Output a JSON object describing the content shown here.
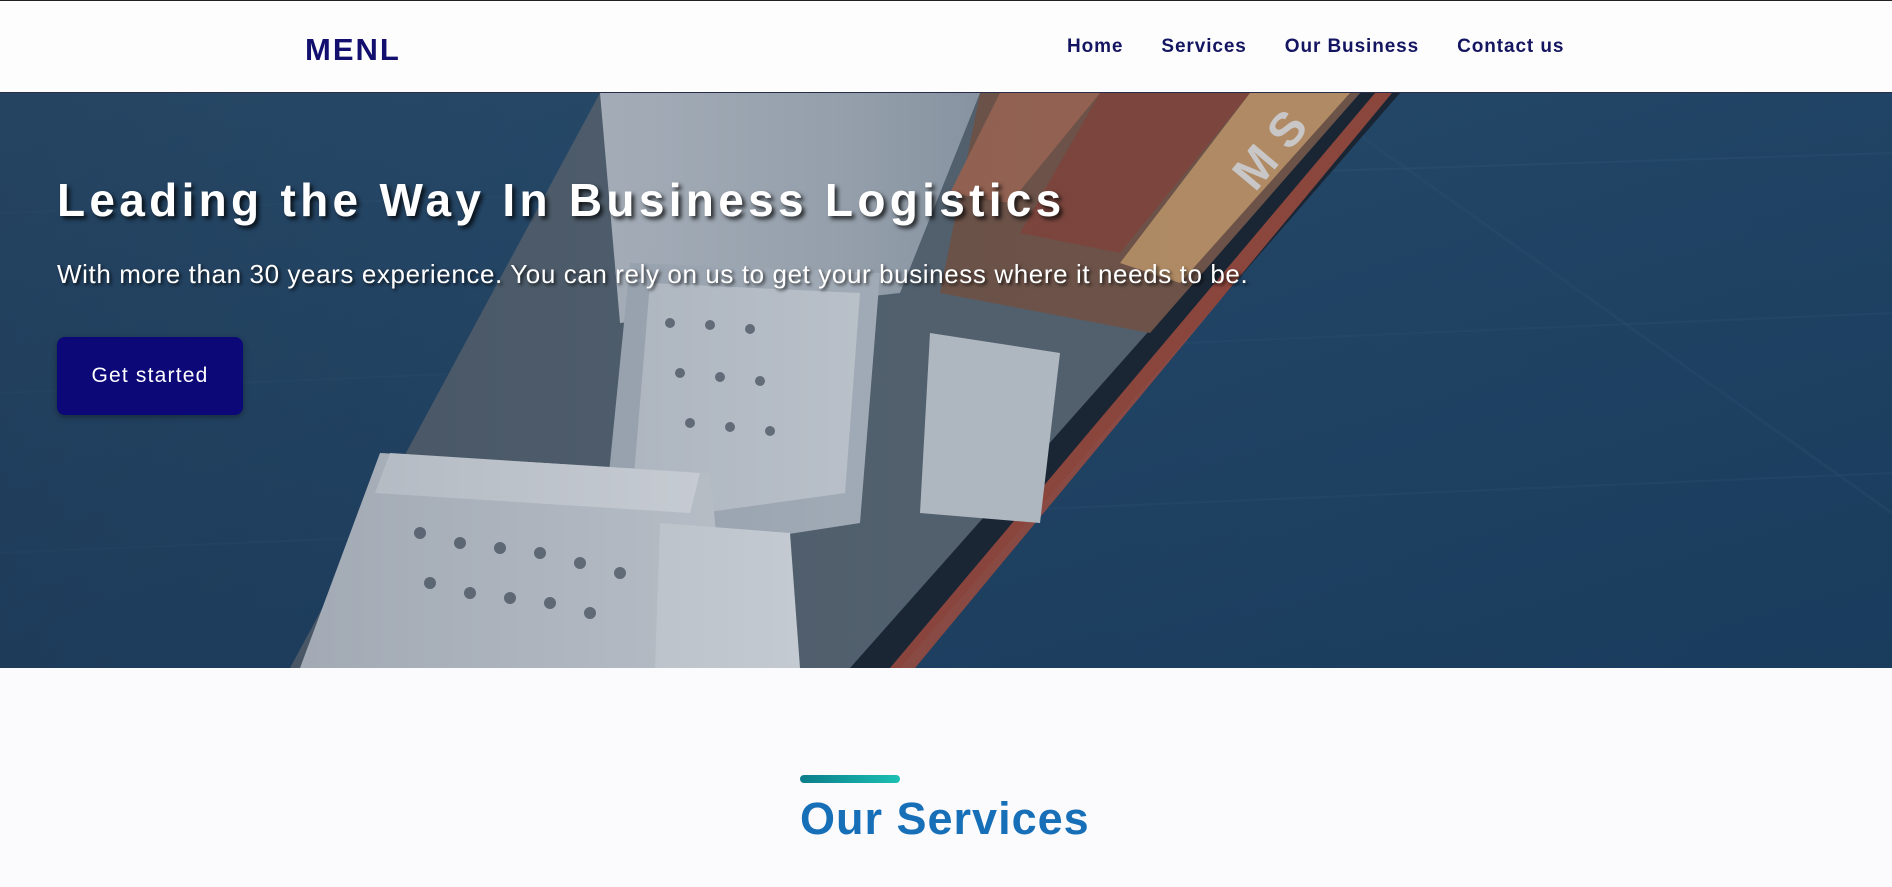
{
  "header": {
    "logo": "MENL",
    "nav": [
      {
        "label": "Home"
      },
      {
        "label": "Services"
      },
      {
        "label": "Our Business"
      },
      {
        "label": "Contact us"
      }
    ]
  },
  "hero": {
    "title": "Leading the Way In Business Logistics",
    "subtitle": "With more than 30 years experience. You can rely on us to get your business where it needs to be.",
    "cta_label": "Get started",
    "background": "container-ship-aerial-image"
  },
  "services": {
    "title": "Our Services"
  },
  "colors": {
    "brand_navy": "#120f6e",
    "cta_bg": "#0c0878",
    "section_title": "#176fb8",
    "accent_bar_start": "#0b7d8a",
    "accent_bar_end": "#1cc0b3"
  }
}
